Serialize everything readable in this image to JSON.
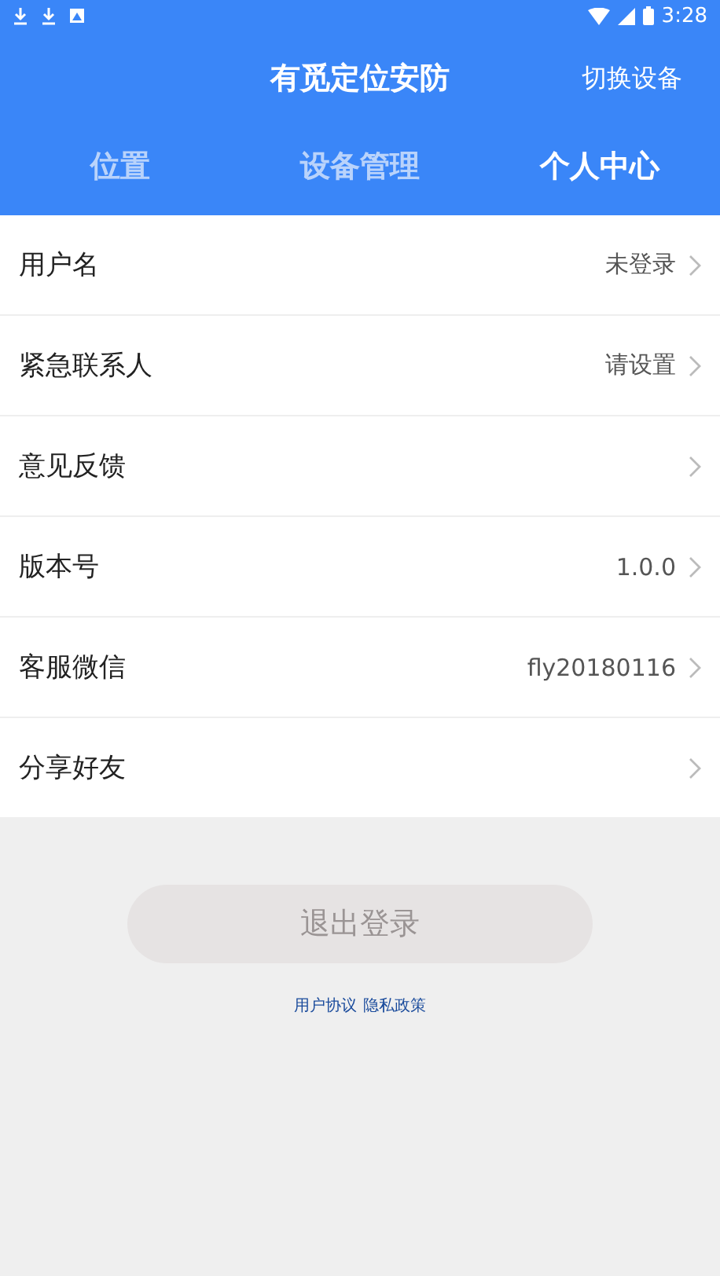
{
  "status_bar": {
    "time": "3:28"
  },
  "header": {
    "title": "有觅定位安防",
    "action": "切换设备"
  },
  "tabs": [
    {
      "label": "位置",
      "selected": false
    },
    {
      "label": "设备管理",
      "selected": false
    },
    {
      "label": "个人中心",
      "selected": true
    }
  ],
  "menu": [
    {
      "label": "用户名",
      "value": "未登录"
    },
    {
      "label": "紧急联系人",
      "value": "请设置"
    },
    {
      "label": "意见反馈"
    },
    {
      "label": "版本号",
      "value": "1.0.0"
    },
    {
      "label": "客服微信",
      "value": "fly20180116"
    },
    {
      "label": "分享好友"
    }
  ],
  "logout_button": {
    "label": "退出登录",
    "disabled": true
  },
  "links": [
    "用户协议",
    "隐私政策"
  ]
}
